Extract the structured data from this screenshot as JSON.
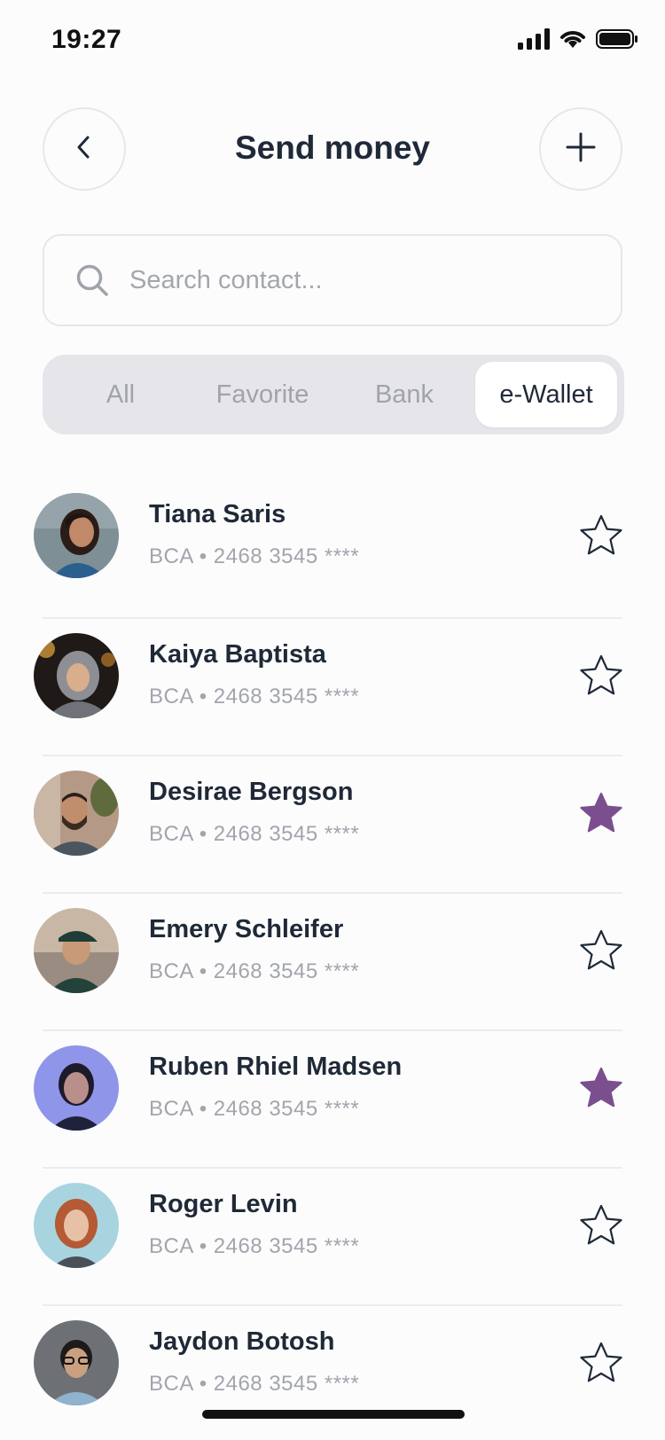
{
  "status_bar": {
    "time": "19:27"
  },
  "header": {
    "title": "Send money"
  },
  "search": {
    "placeholder": "Search contact..."
  },
  "tabs": [
    {
      "label": "All",
      "active": false
    },
    {
      "label": "Favorite",
      "active": false
    },
    {
      "label": "Bank",
      "active": false
    },
    {
      "label": "e-Wallet",
      "active": true
    }
  ],
  "contacts": [
    {
      "name": "Tiana Saris",
      "account": "BCA • 2468 3545 ****",
      "favorite": false
    },
    {
      "name": "Kaiya Baptista",
      "account": "BCA • 2468 3545 ****",
      "favorite": false
    },
    {
      "name": "Desirae Bergson",
      "account": "BCA • 2468 3545 ****",
      "favorite": true
    },
    {
      "name": "Emery Schleifer",
      "account": "BCA • 2468 3545 ****",
      "favorite": false
    },
    {
      "name": "Ruben Rhiel Madsen",
      "account": "BCA • 2468 3545 ****",
      "favorite": true
    },
    {
      "name": "Roger Levin",
      "account": "BCA • 2468 3545 ****",
      "favorite": false
    },
    {
      "name": "Jaydon Botosh",
      "account": "BCA • 2468 3545 ****",
      "favorite": false
    }
  ],
  "colors": {
    "favorite_star": "#7b4f8e",
    "text_primary": "#1f2937",
    "text_secondary": "#a2a5ac"
  }
}
